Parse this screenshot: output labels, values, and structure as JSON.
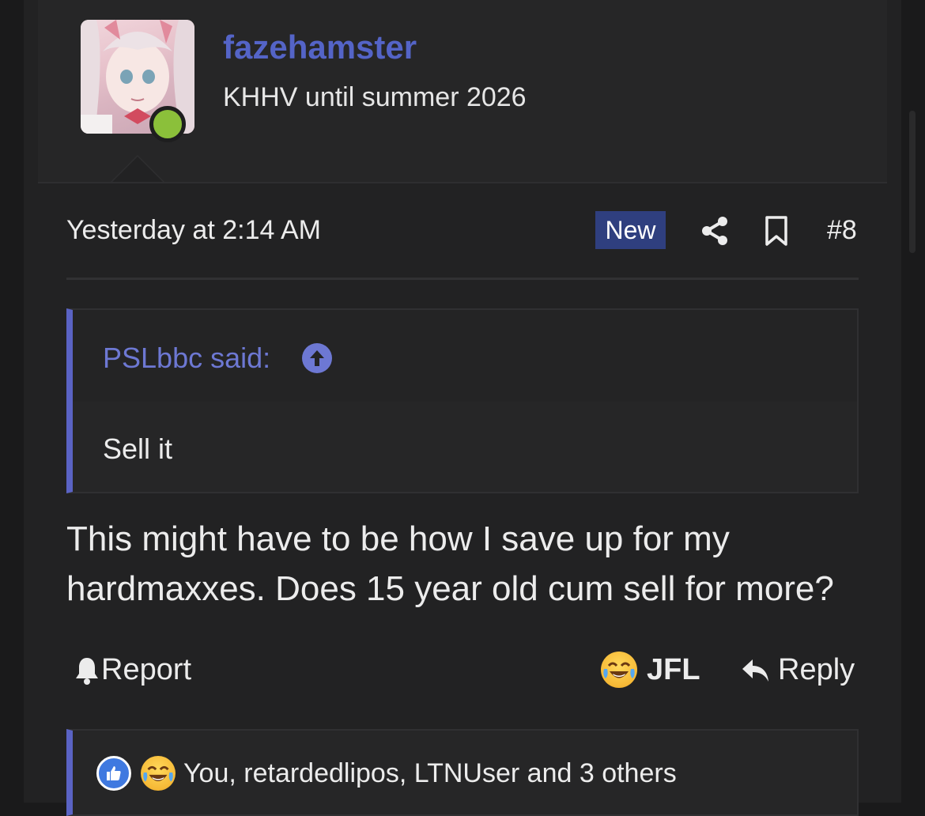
{
  "user": {
    "name": "fazehamster",
    "title": "KHHV until summer 2026",
    "online": true
  },
  "post": {
    "timestamp": "Yesterday at 2:14 AM",
    "new_label": "New",
    "number": "#8",
    "message": "This might have to be how I save up for my hardmaxxes. Does 15 year old cum sell for more?"
  },
  "quote": {
    "author": "PSLbbc said:",
    "body": "Sell it"
  },
  "actions": {
    "report": "Report",
    "reaction": "JFL",
    "reply": "Reply"
  },
  "reactions": {
    "summary": "You, retardedlipos, LTNUser and 3 others"
  },
  "colors": {
    "accent": "#5464c7",
    "quote_bar": "#5a63c4",
    "new_badge": "#2f3f7f",
    "online": "#8bc03a"
  }
}
